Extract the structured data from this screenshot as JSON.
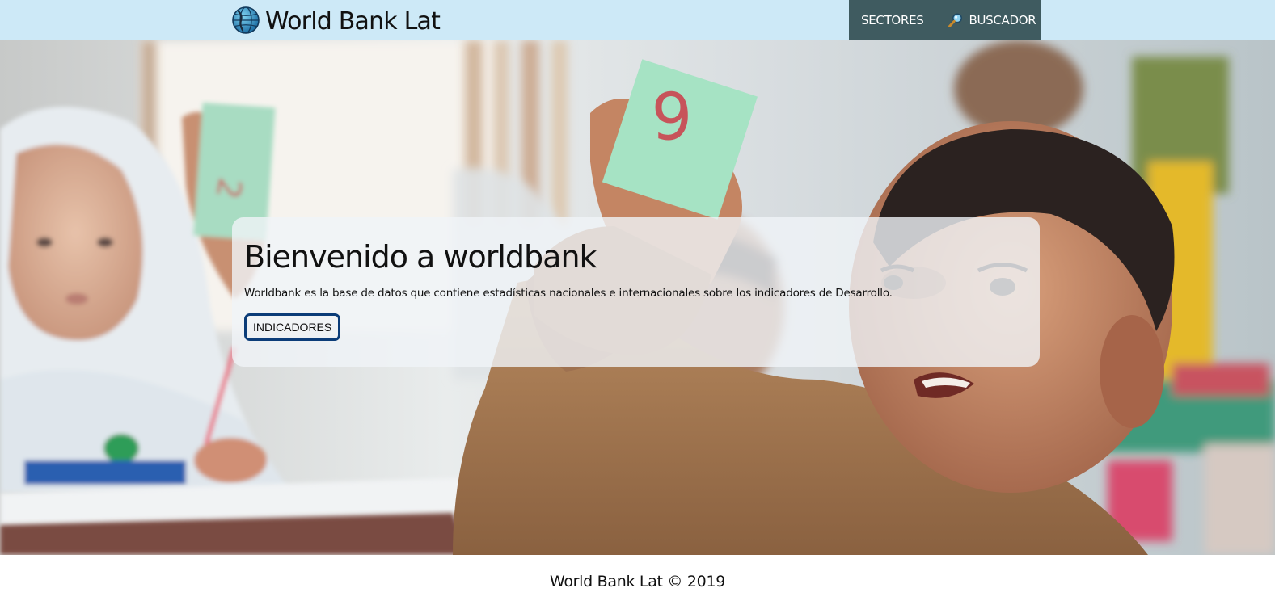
{
  "header": {
    "brand_title": "World Bank Lat",
    "logo_icon": "globe-icon",
    "nav": [
      {
        "label": "SECTORES"
      },
      {
        "label": "BUSCADOR",
        "icon": "magnifier-icon"
      }
    ]
  },
  "hero": {
    "title": "Bienvenido a worldbank",
    "description": "Worldbank es la base de datos que contiene estadísticas nacionales e internacionales sobre los indicadores de Desarrollo.",
    "button_label": "INDICADORES",
    "background": "classroom-children-photo"
  },
  "footer": {
    "text": "World Bank Lat © 2019"
  },
  "colors": {
    "header_bg": "#cde9f7",
    "nav_bg": "#3f5b60",
    "button_border": "#0b3c78",
    "card_bg": "rgba(240,244,248,0.80)"
  }
}
